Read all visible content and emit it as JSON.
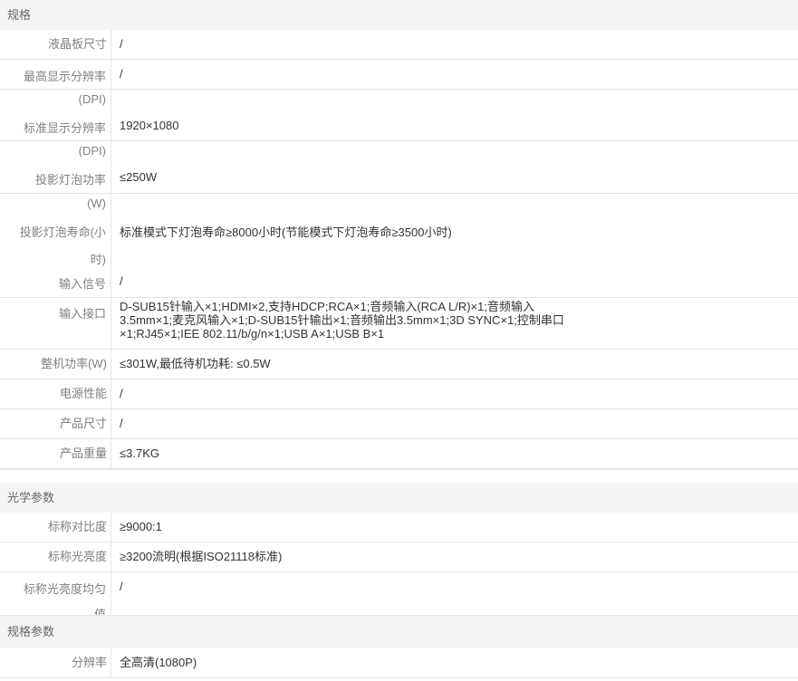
{
  "sections": [
    {
      "title": "规格",
      "rows": [
        {
          "label": "液晶板尺寸",
          "value": "/"
        },
        {
          "label": "最高显示分辨率",
          "value": "/"
        },
        {
          "label": "(DPI)",
          "value": ""
        },
        {
          "label": "标准显示分辨率",
          "value": "1920×1080"
        },
        {
          "label": "(DPI)",
          "value": ""
        },
        {
          "label": "投影灯泡功率",
          "value": "≤250W"
        },
        {
          "label": "(W)",
          "value": ""
        },
        {
          "label": "投影灯泡寿命(小",
          "value": "标准模式下灯泡寿命≥8000小时(节能模式下灯泡寿命≥3500小时)"
        },
        {
          "label": "时)",
          "value": ""
        },
        {
          "label": "输入信号",
          "value": "/"
        },
        {
          "label": "输入接口",
          "value": [
            "D-SUB15针输入×1;HDMI×2,支持HDCP;RCA×1;音频输入(RCA L/R)×1;音频输入",
            "3.5mm×1;麦克风输入×1;D-SUB15针输出×1;音频输出3.5mm×1;3D SYNC×1;控制串口",
            "×1;RJ45×1;IEE 802.11/b/g/n×1;USB A×1;USB B×1"
          ]
        },
        {
          "label": "整机功率(W)",
          "value": "≤301W,最低待机功耗: ≤0.5W"
        },
        {
          "label": "电源性能",
          "value": "/"
        },
        {
          "label": "产品尺寸",
          "value": "/"
        },
        {
          "label": "产品重量",
          "value": "≤3.7KG"
        }
      ]
    },
    {
      "title": "光学参数",
      "rows": [
        {
          "label": "标称对比度",
          "value": "≥9000:1"
        },
        {
          "label": "标称光亮度",
          "value": "≥3200流明(根据ISO21118标准)"
        },
        {
          "label": "标称光亮度均匀",
          "value": "/"
        },
        {
          "label": "值",
          "value": ""
        }
      ]
    },
    {
      "title": "规格参数",
      "rows": [
        {
          "label": "分辨率",
          "value": "全高清(1080P)"
        }
      ]
    }
  ]
}
